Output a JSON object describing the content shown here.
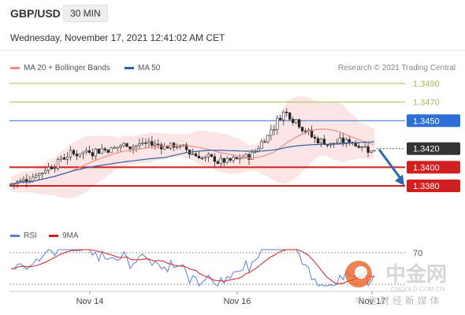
{
  "header": {
    "pair": "GBP/USD",
    "timeframe": "30 MIN"
  },
  "datetime": "Wednesday, November 17, 2021 12:41:02 AM CET",
  "legend": {
    "ma20": "MA 20 + Bollinger Bands",
    "ma50": "MA 50"
  },
  "credit": "Research © 2021 Trading Central",
  "rsi_legend": {
    "rsi": "RSI",
    "ma9": "9MA"
  },
  "colors": {
    "ma20": "#f28b8b",
    "ma50": "#2c5fa6",
    "green_level": "#9bc25a",
    "blue_level": "#2c6fd6",
    "red_level": "#d11f1f",
    "arrow": "#2c6ab0",
    "current": "#333333",
    "band": "#fbdada",
    "rsi": "#5b7fd6",
    "rsi_ma": "#d11f1f"
  },
  "watermark": {
    "logo": "中金网",
    "site": "CNGOLD.COM.CN",
    "tagline": "中 金 财 经 新 媒 体"
  },
  "chart_data": {
    "type": "candlestick",
    "x_ticks": [
      "Nov 14",
      "Nov 16",
      "Nov 17"
    ],
    "price_levels": [
      {
        "value": 1.349,
        "label": "1.3490",
        "kind": "green"
      },
      {
        "value": 1.347,
        "label": "1.3470",
        "kind": "green"
      },
      {
        "value": 1.345,
        "label": "1.3450",
        "kind": "blue"
      },
      {
        "value": 1.342,
        "label": "1.3420",
        "kind": "current"
      },
      {
        "value": 1.34,
        "label": "1.3400",
        "kind": "red"
      },
      {
        "value": 1.338,
        "label": "1.3380",
        "kind": "red"
      }
    ],
    "rsi_levels": [
      {
        "value": 70,
        "label": "70"
      }
    ]
  }
}
